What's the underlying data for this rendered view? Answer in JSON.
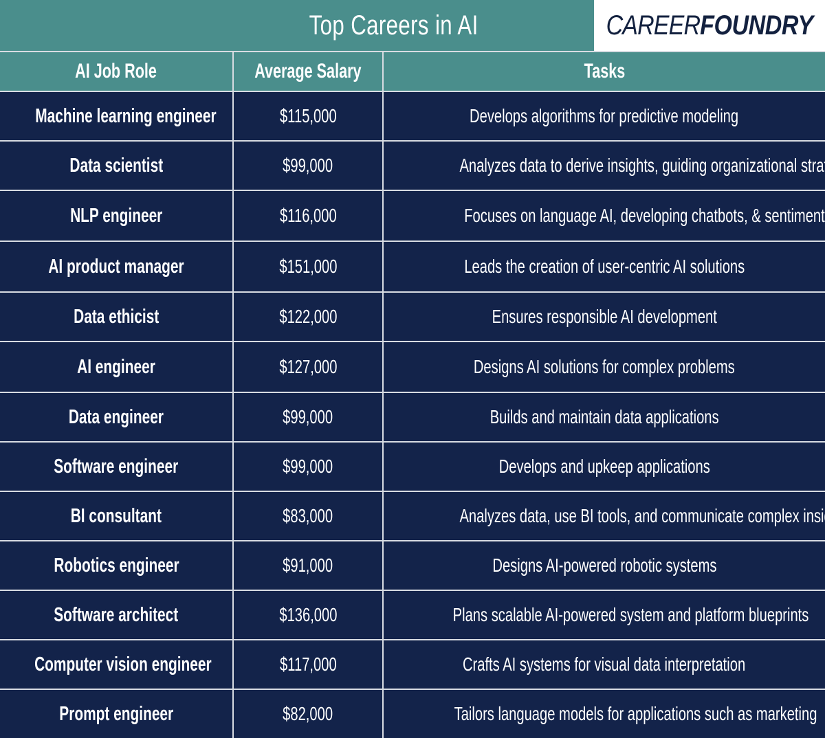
{
  "header": {
    "title": "Top Careers in AI",
    "logo_light": "CAREER",
    "logo_bold": "FOUNDRY"
  },
  "colors": {
    "teal_header": "#4a8e8c",
    "navy_cell": "#13234a",
    "grid_line": "#d8dce2",
    "text": "#ffffff",
    "logo_text": "#13213f"
  },
  "table": {
    "columns": [
      "AI Job Role",
      "Average Salary",
      "Tasks"
    ],
    "rows": [
      {
        "role": "Machine learning engineer",
        "salary": "$115,000",
        "task": "Develops algorithms for predictive modeling"
      },
      {
        "role": "Data scientist",
        "salary": "$99,000",
        "task": "Analyzes data to derive insights, guiding organizational strategy"
      },
      {
        "role": "NLP engineer",
        "salary": "$116,000",
        "task": "Focuses on language AI, developing chatbots, & sentiment analysis"
      },
      {
        "role": "AI product manager",
        "salary": "$151,000",
        "task": "Leads the creation of user-centric AI solutions"
      },
      {
        "role": "Data ethicist",
        "salary": "$122,000",
        "task": "Ensures responsible AI development"
      },
      {
        "role": "AI engineer",
        "salary": "$127,000",
        "task": "Designs AI solutions for complex problems"
      },
      {
        "role": "Data engineer",
        "salary": "$99,000",
        "task": "Builds and maintain data applications"
      },
      {
        "role": "Software engineer",
        "salary": "$99,000",
        "task": "Develops and upkeep applications"
      },
      {
        "role": "BI consultant",
        "salary": "$83,000",
        "task": "Analyzes data, use BI tools, and communicate complex insights"
      },
      {
        "role": "Robotics engineer",
        "salary": "$91,000",
        "task": "Designs AI-powered robotic systems"
      },
      {
        "role": "Software architect",
        "salary": "$136,000",
        "task": "Plans scalable AI-powered system and platform blueprints"
      },
      {
        "role": "Computer vision engineer",
        "salary": "$117,000",
        "task": "Crafts AI systems for visual data interpretation"
      },
      {
        "role": "Prompt engineer",
        "salary": "$82,000",
        "task": "Tailors language models for applications such as marketing"
      }
    ]
  }
}
